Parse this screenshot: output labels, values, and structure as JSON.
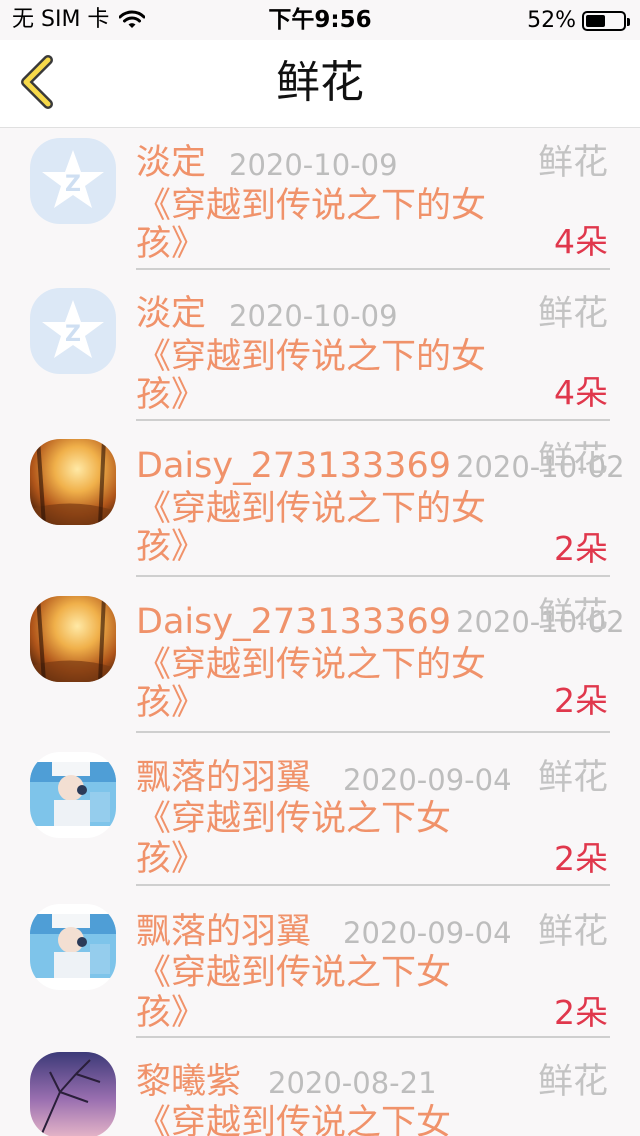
{
  "status_bar": {
    "carrier": "无 SIM 卡",
    "time": "下午9:56",
    "battery_percent": "52%",
    "battery_level": 0.52
  },
  "nav": {
    "back_icon": "chevron-left-icon",
    "title": "鲜花"
  },
  "colors": {
    "accent_orange": "#f0926a",
    "count_red": "#e0374c",
    "muted_gray": "#bdbdbd",
    "back_yellow": "#f7d94a"
  },
  "items": [
    {
      "avatar": "qq-star-icon",
      "name": "淡定",
      "date": "2020-10-09",
      "type": "鲜花",
      "book_line1": "《穿越到传说之下的女",
      "book_line2": "孩》",
      "count": "4朵"
    },
    {
      "avatar": "qq-star-icon",
      "name": "淡定",
      "date": "2020-10-09",
      "type": "鲜花",
      "book_line1": "《穿越到传说之下的女",
      "book_line2": "孩》",
      "count": "4朵"
    },
    {
      "avatar": "autumn-forest-photo",
      "name": "Daisy_273133369",
      "date": "2020-10-02",
      "type": "鲜花",
      "book_line1": "《穿越到传说之下的女",
      "book_line2": "孩》",
      "count": "2朵"
    },
    {
      "avatar": "autumn-forest-photo",
      "name": "Daisy_273133369",
      "date": "2020-10-02",
      "type": "鲜花",
      "book_line1": "《穿越到传说之下的女",
      "book_line2": "孩》",
      "count": "2朵"
    },
    {
      "avatar": "anime-character-photo",
      "name": "飘落的羽翼",
      "date": "2020-09-04",
      "type": "鲜花",
      "book_line1": "《穿越到传说之下女",
      "book_line2": "孩》",
      "count": "2朵"
    },
    {
      "avatar": "anime-character-photo",
      "name": "飘落的羽翼",
      "date": "2020-09-04",
      "type": "鲜花",
      "book_line1": "《穿越到传说之下女",
      "book_line2": "孩》",
      "count": "2朵"
    },
    {
      "avatar": "purple-sky-photo",
      "name": "黎曦紫",
      "date": "2020-08-21",
      "type": "鲜花",
      "book_line1": "《穿越到传说之下女",
      "book_line2": "",
      "count": ""
    }
  ]
}
